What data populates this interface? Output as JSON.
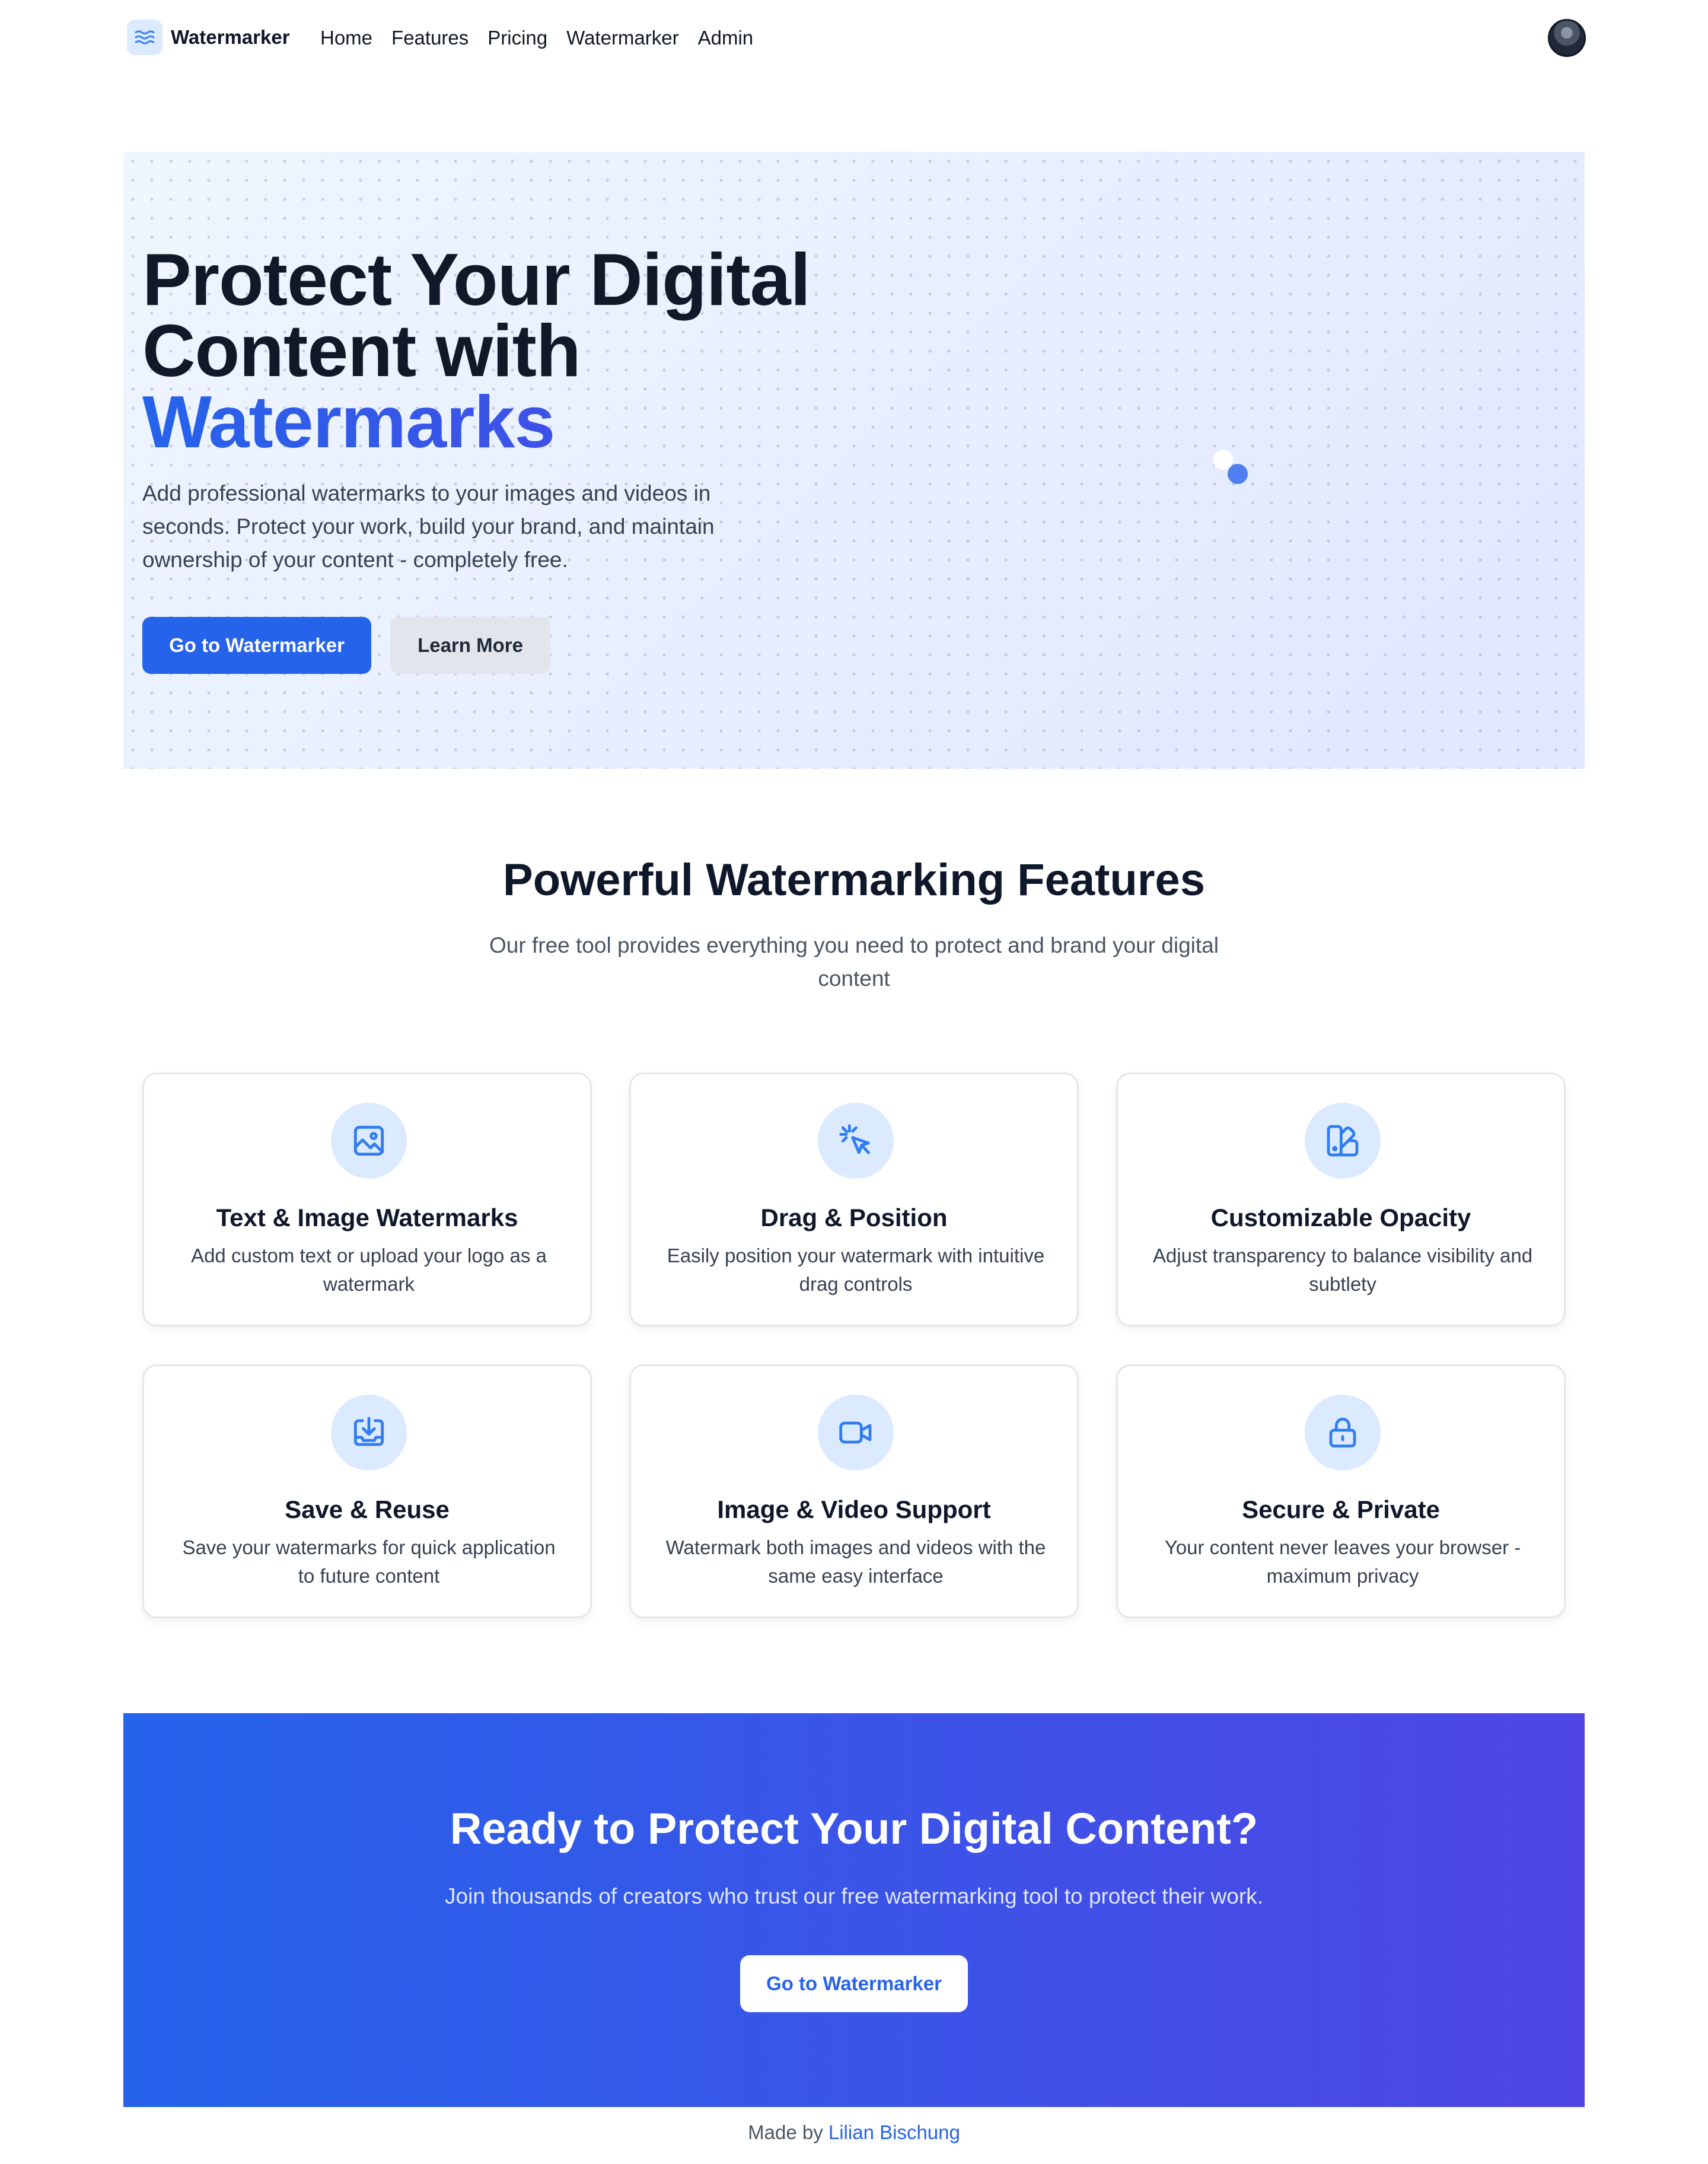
{
  "nav": {
    "brand": "Watermarker",
    "links": [
      "Home",
      "Features",
      "Pricing",
      "Watermarker",
      "Admin"
    ]
  },
  "hero": {
    "title_line1": "Protect Your Digital",
    "title_line2": "Content with",
    "title_accent": "Watermarks",
    "description": "Add professional watermarks to your images and videos in seconds. Protect your work, build your brand, and maintain ownership of your content - completely free.",
    "primary_button": "Go to Watermarker",
    "secondary_button": "Learn More"
  },
  "features": {
    "title": "Powerful Watermarking Features",
    "subtitle": "Our free tool provides everything you need to protect and brand your digital content",
    "items": [
      {
        "icon": "image-icon",
        "title": "Text & Image Watermarks",
        "description": "Add custom text or upload your logo as a watermark"
      },
      {
        "icon": "pointer-click-icon",
        "title": "Drag & Position",
        "description": "Easily position your watermark with intuitive drag controls"
      },
      {
        "icon": "swatch-icon",
        "title": "Customizable Opacity",
        "description": "Adjust transparency to balance visibility and subtlety"
      },
      {
        "icon": "save-download-icon",
        "title": "Save & Reuse",
        "description": "Save your watermarks for quick application to future content"
      },
      {
        "icon": "video-camera-icon",
        "title": "Image & Video Support",
        "description": "Watermark both images and videos with the same easy interface"
      },
      {
        "icon": "lock-icon",
        "title": "Secure & Private",
        "description": "Your content never leaves your browser - maximum privacy"
      }
    ]
  },
  "cta": {
    "title": "Ready to Protect Your Digital Content?",
    "description": "Join thousands of creators who trust our free watermarking tool to protect their work.",
    "button": "Go to Watermarker"
  },
  "footer": {
    "prefix": "Made by",
    "author": "Lilian Bischung"
  },
  "colors": {
    "primary": "#2563eb",
    "accent_gradient_end": "#4f46e5",
    "icon_bg": "#dbeafe",
    "text_dark": "#0f172a"
  }
}
